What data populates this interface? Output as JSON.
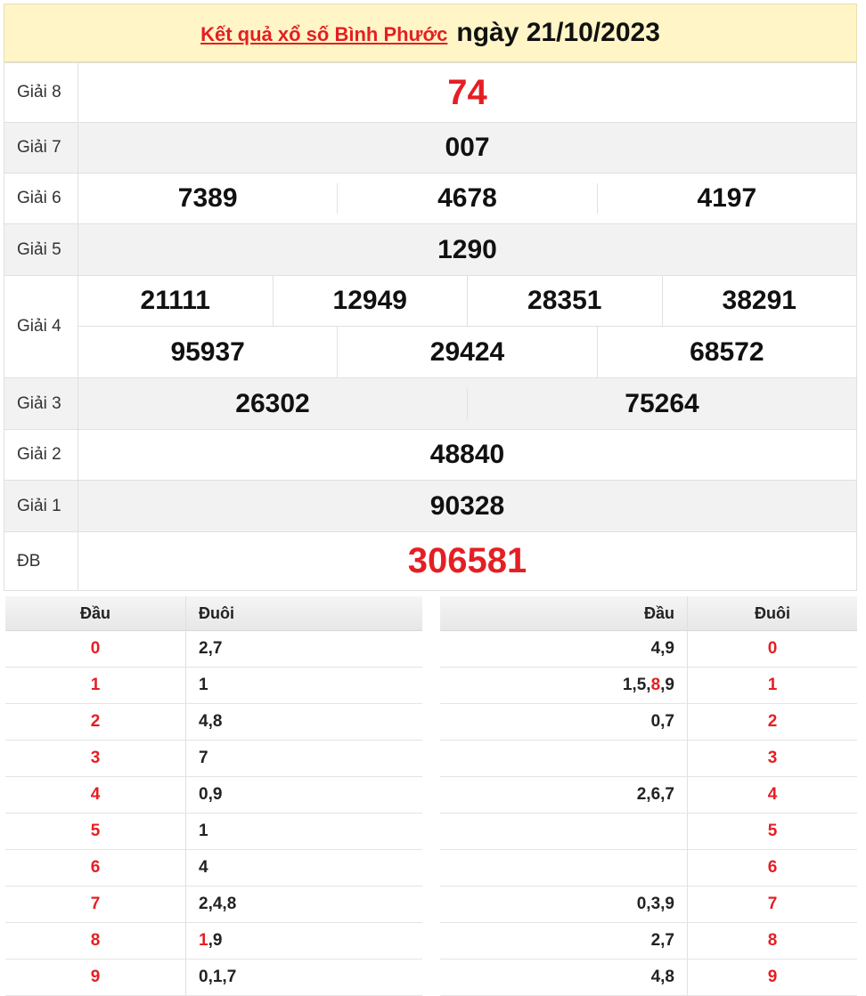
{
  "header": {
    "link_text": "Kết quả xổ số Bình Phước",
    "date_text": "ngày 21/10/2023"
  },
  "prizes": [
    {
      "label": "Giải 8",
      "numbers": [
        "74"
      ]
    },
    {
      "label": "Giải 7",
      "numbers": [
        "007"
      ]
    },
    {
      "label": "Giải 6",
      "numbers": [
        "7389",
        "4678",
        "4197"
      ]
    },
    {
      "label": "Giải 5",
      "numbers": [
        "1290"
      ]
    },
    {
      "label": "Giải 4",
      "numbers": [
        "21111",
        "12949",
        "28351",
        "38291",
        "95937",
        "29424",
        "68572"
      ]
    },
    {
      "label": "Giải 3",
      "numbers": [
        "26302",
        "75264"
      ]
    },
    {
      "label": "Giải 2",
      "numbers": [
        "48840"
      ]
    },
    {
      "label": "Giải 1",
      "numbers": [
        "90328"
      ]
    },
    {
      "label": "ĐB",
      "numbers": [
        "306581"
      ]
    }
  ],
  "loto": {
    "head_label": "Đầu",
    "tail_label": "Đuôi",
    "left_rows": [
      {
        "head": "0",
        "tail": "2,7"
      },
      {
        "head": "1",
        "tail": "1"
      },
      {
        "head": "2",
        "tail": "4,8"
      },
      {
        "head": "3",
        "tail": "7"
      },
      {
        "head": "4",
        "tail": "0,9"
      },
      {
        "head": "5",
        "tail": "1"
      },
      {
        "head": "6",
        "tail": "4"
      },
      {
        "head": "7",
        "tail": "2,4,8"
      },
      {
        "head": "8",
        "tail": "1,9"
      },
      {
        "head": "9",
        "tail": "0,1,7"
      }
    ],
    "right_rows": [
      {
        "head": "4,9",
        "tail": "0"
      },
      {
        "head": "1,5,8,9",
        "tail": "1"
      },
      {
        "head": "0,7",
        "tail": "2"
      },
      {
        "head": "",
        "tail": "3"
      },
      {
        "head": "2,6,7",
        "tail": "4"
      },
      {
        "head": "",
        "tail": "5"
      },
      {
        "head": "",
        "tail": "6"
      },
      {
        "head": "0,3,9",
        "tail": "7"
      },
      {
        "head": "2,7",
        "tail": "8"
      },
      {
        "head": "4,8",
        "tail": "9"
      }
    ]
  },
  "colors": {
    "accent_red": "#e41f24",
    "header_bg": "#fff5c6",
    "row_gray": "#f2f2f2"
  }
}
